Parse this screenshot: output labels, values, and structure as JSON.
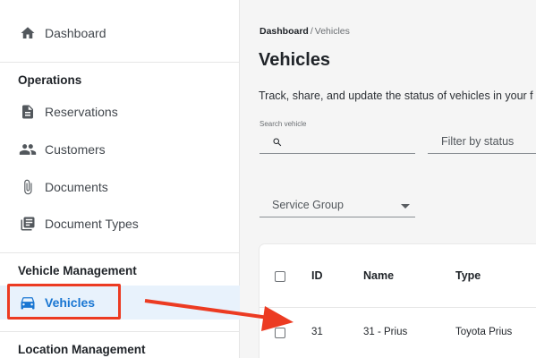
{
  "sidebar": {
    "dashboard": {
      "label": "Dashboard",
      "icon": "home-icon"
    },
    "operations": {
      "title": "Operations",
      "items": [
        {
          "label": "Reservations",
          "icon": "document-icon"
        },
        {
          "label": "Customers",
          "icon": "people-icon"
        },
        {
          "label": "Documents",
          "icon": "paperclip-icon"
        },
        {
          "label": "Document Types",
          "icon": "library-icon"
        }
      ]
    },
    "vehicle_management": {
      "title": "Vehicle Management",
      "items": [
        {
          "label": "Vehicles",
          "icon": "car-icon",
          "active": true
        }
      ]
    },
    "location_management": {
      "title": "Location Management"
    }
  },
  "main": {
    "breadcrumb": {
      "home": "Dashboard",
      "separator": "/",
      "current": "Vehicles"
    },
    "title": "Vehicles",
    "description": "Track, share, and update the status of vehicles in your f",
    "search": {
      "label": "Search vehicle",
      "value": "",
      "icon": "search-icon"
    },
    "status_filter": {
      "placeholder": "Filter by status"
    },
    "service_group": {
      "value": "Service Group"
    },
    "table": {
      "columns": [
        "ID",
        "Name",
        "Type"
      ],
      "rows": [
        {
          "id": "31",
          "name": "31 - Prius",
          "type": "Toyota Prius"
        }
      ]
    }
  },
  "colors": {
    "accent": "#1976d2",
    "active_bg": "#e8f2fc",
    "annotation": "#ec3b22"
  }
}
